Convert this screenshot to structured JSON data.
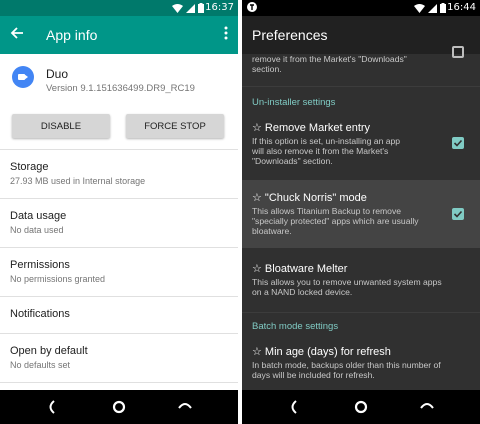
{
  "left_screen": {
    "status": {
      "time": "16:37"
    },
    "appbar": {
      "title": "App info"
    },
    "app": {
      "name": "Duo",
      "version": "Version 9.1.151636499.DR9_RC19"
    },
    "buttons": {
      "disable": "DISABLE",
      "force_stop": "FORCE STOP"
    },
    "items": [
      {
        "title": "Storage",
        "subtitle": "27.93 MB used in Internal storage"
      },
      {
        "title": "Data usage",
        "subtitle": "No data used"
      },
      {
        "title": "Permissions",
        "subtitle": "No permissions granted"
      },
      {
        "title": "Notifications",
        "subtitle": ""
      },
      {
        "title": "Open by default",
        "subtitle": "No defaults set"
      }
    ],
    "colors": {
      "statusbar": "#00796b",
      "appbar": "#009688"
    }
  },
  "right_screen": {
    "status": {
      "time": "16:44"
    },
    "appbar": {
      "title": "Preferences"
    },
    "top_partial": {
      "line1": "remove it from the Market's \"Downloads\"",
      "line2": "section."
    },
    "sections": {
      "uninstaller": "Un-installer settings",
      "batch": "Batch mode settings"
    },
    "prefs": [
      {
        "title": "☆ Remove Market entry",
        "desc1": "If this option is set, un-installing an app",
        "desc2": "will also remove it from the Market's",
        "desc3": "\"Downloads\" section.",
        "checked": true
      },
      {
        "title": "☆ \"Chuck Norris\" mode",
        "desc1": "This allows Titanium Backup to remove",
        "desc2": "\"specially protected\" apps which are usually",
        "desc3": "bloatware.",
        "checked": true
      },
      {
        "title": "☆ Bloatware Melter",
        "desc1": "This allows you to remove unwanted system apps",
        "desc2": "on a NAND locked device.",
        "desc3": ""
      },
      {
        "title": "☆ Min age (days) for refresh",
        "desc1": "In batch mode, backups older than this number of",
        "desc2": "days will be included for refresh.",
        "desc3": ""
      }
    ],
    "colors": {
      "accent": "#80cbc4",
      "background": "#303030",
      "appbar": "#212121"
    }
  }
}
